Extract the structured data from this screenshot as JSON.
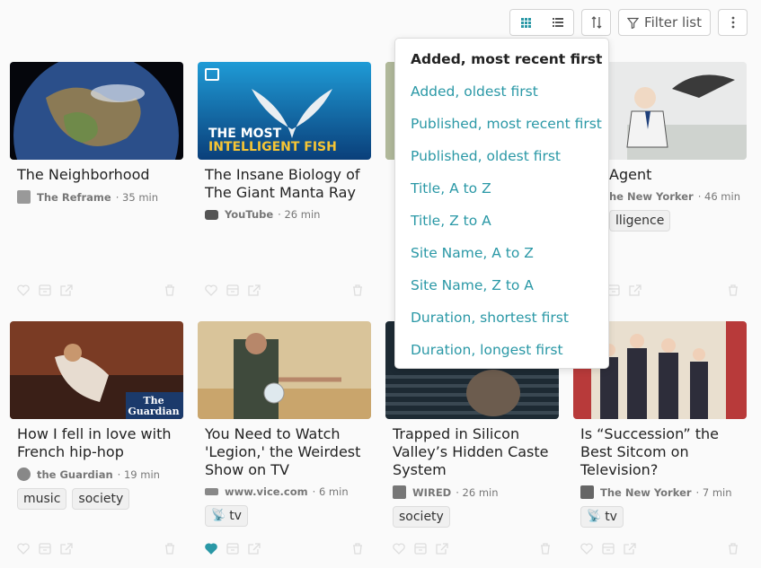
{
  "toolbar": {
    "view_grid_icon": "grid-icon",
    "view_list_icon": "list-icon",
    "sort_icon": "sort-icon",
    "filter_label": "Filter list",
    "more_icon": "more-vertical-icon"
  },
  "sort_menu": {
    "items": [
      "Added, most recent first",
      "Added, oldest first",
      "Published, most recent first",
      "Published, oldest first",
      "Title, A to Z",
      "Title, Z to A",
      "Site Name, A to Z",
      "Site Name, Z to A",
      "Duration, shortest first",
      "Duration, longest first"
    ],
    "selected": "Added, most recent first"
  },
  "cards": [
    {
      "title": "The Neighborhood",
      "site": "The Reframe",
      "duration": "· 35 min",
      "tags": []
    },
    {
      "title": "The Insane Biology of The Giant Manta Ray",
      "site": "YouTube",
      "duration": "· 26 min",
      "tags": [],
      "thumb_text": "THE MOST",
      "thumb_text2": "INTELLIGENT FISH"
    },
    {
      "title": "",
      "site": "",
      "duration": "",
      "tags": []
    },
    {
      "title": "Agent",
      "site": "he New Yorker",
      "duration": "· 46 min",
      "tags": [
        "lligence"
      ]
    },
    {
      "title": "How I fell in love with French hip-hop",
      "site": "the Guardian",
      "duration": "· 19 min",
      "tags": [
        "music",
        "society"
      ],
      "thumb_text": "The",
      "thumb_text2": "Guardian"
    },
    {
      "title": "You Need to Watch 'Legion,' the Weirdest Show on TV",
      "site": "www.vice.com",
      "duration": "· 6 min",
      "tags": [
        "tv"
      ]
    },
    {
      "title": "Trapped in Silicon Valley’s Hidden Caste System",
      "site": "WIRED",
      "duration": "· 26 min",
      "tags": [
        "society"
      ]
    },
    {
      "title": "Is “Succession” the Best Sitcom on Television?",
      "site": "The New Yorker",
      "duration": "· 7 min",
      "tags": [
        "tv"
      ]
    }
  ],
  "colors": {
    "accent": "#2a98a6"
  }
}
